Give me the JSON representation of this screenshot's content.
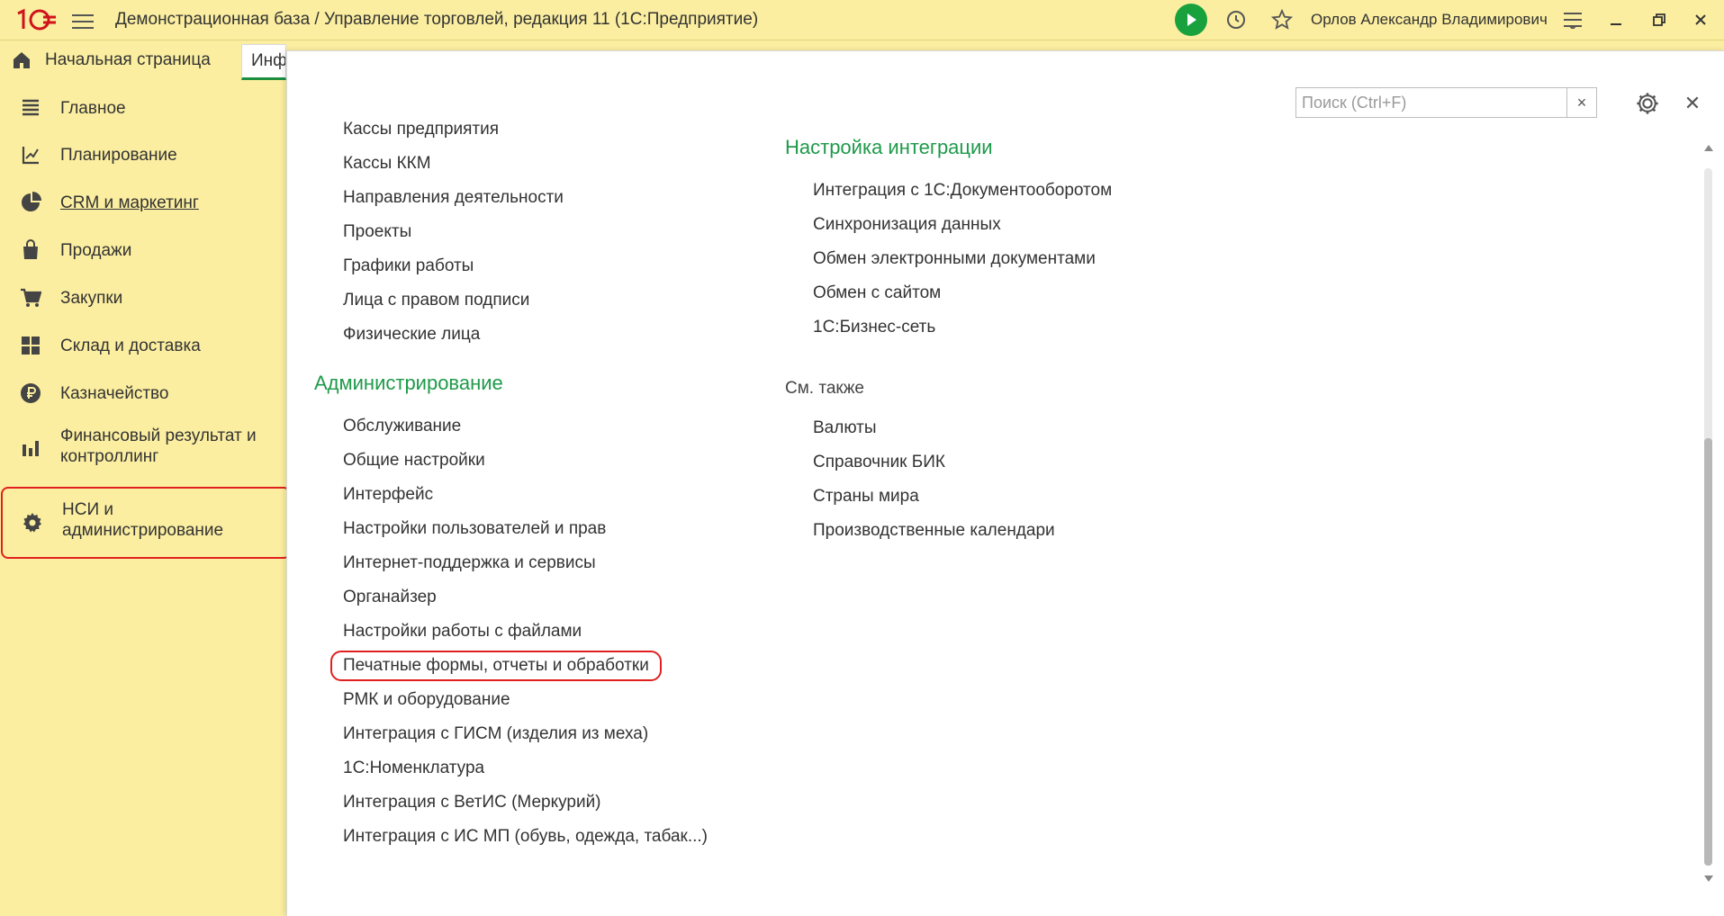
{
  "header": {
    "title": "Демонстрационная база / Управление торговлей, редакция 11  (1С:Предприятие)",
    "user": "Орлов Александр Владимирович"
  },
  "tabs": {
    "home": "Начальная страница",
    "active": "Инф"
  },
  "sidebar": {
    "items": [
      {
        "label": "Главное",
        "icon": "list-icon"
      },
      {
        "label": "Планирование",
        "icon": "planning-icon"
      },
      {
        "label": "CRM и маркетинг",
        "icon": "pie-chart-icon"
      },
      {
        "label": "Продажи",
        "icon": "bag-icon"
      },
      {
        "label": "Закупки",
        "icon": "cart-icon"
      },
      {
        "label": "Склад и доставка",
        "icon": "warehouse-icon"
      },
      {
        "label": "Казначейство",
        "icon": "ruble-icon"
      },
      {
        "label": "Финансовый результат и контроллинг",
        "icon": "bar-chart-icon"
      },
      {
        "label": "НСИ и администрирование",
        "icon": "gear-icon"
      }
    ]
  },
  "search": {
    "placeholder": "Поиск (Ctrl+F)",
    "clear": "×"
  },
  "left_column": {
    "top_links": [
      "Кассы предприятия",
      "Кассы ККМ",
      "Направления деятельности",
      "Проекты",
      "Графики работы",
      "Лица с правом подписи",
      "Физические лица"
    ],
    "admin_title": "Администрирование",
    "admin_links": [
      "Обслуживание",
      "Общие настройки",
      "Интерфейс",
      "Настройки пользователей и прав",
      "Интернет-поддержка и сервисы",
      "Органайзер",
      "Настройки работы с файлами",
      "Печатные формы, отчеты и обработки",
      "РМК и оборудование",
      "Интеграция с ГИСМ (изделия из меха)",
      "1С:Номенклатура",
      "Интеграция с ВетИС (Меркурий)",
      "Интеграция с ИС МП (обувь, одежда, табак...)"
    ]
  },
  "right_column": {
    "integration_title": "Настройка интеграции",
    "integration_links": [
      "Интеграция с 1С:Документооборотом",
      "Синхронизация данных",
      "Обмен электронными документами",
      "Обмен с сайтом",
      "1С:Бизнес-сеть"
    ],
    "see_also_title": "См. также",
    "see_also_links": [
      "Валюты",
      "Справочник БИК",
      "Страны мира",
      "Производственные календари"
    ]
  },
  "colors": {
    "background": "#fbeea0",
    "accent_green": "#1e9a4a",
    "highlight_red": "#e02020",
    "play_green": "#19a13e"
  }
}
